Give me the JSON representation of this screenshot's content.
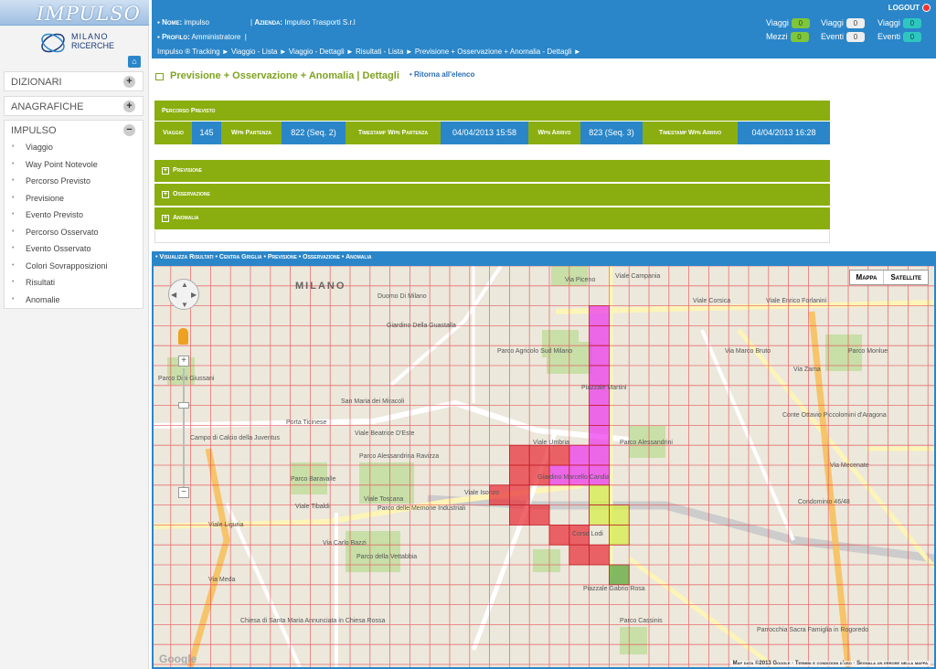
{
  "brand": {
    "logo_text": "IMPULSO",
    "org_line1": "MILANO",
    "org_line2": "RICERCHE"
  },
  "colors": {
    "blue": "#2a86c9",
    "green": "#8aae0f",
    "grid": "#e8484f",
    "magenta": "#ec3cec",
    "red": "#e8343c",
    "yellow": "#d6ee4a",
    "dark_green": "#5fa83a"
  },
  "sidebar": {
    "sections": [
      {
        "label": "DIZIONARI",
        "toggle": "+"
      },
      {
        "label": "ANAGRAFICHE",
        "toggle": "+"
      },
      {
        "label": "IMPULSO",
        "toggle": "−"
      }
    ],
    "items": [
      "Viaggio",
      "Way Point Notevole",
      "Percorso Previsto",
      "Previsione",
      "Evento Previsto",
      "Percorso Osservato",
      "Evento Osservato",
      "Colori Sovrapposizioni",
      "Risultati",
      "Anomalie"
    ]
  },
  "header": {
    "nome_label": "Nome:",
    "nome_value": "impulso",
    "azienda_label": "Azienda:",
    "azienda_value": "Impulso Trasporti S.r.l",
    "profilo_label": "Profilo:",
    "profilo_value": "Amministratore",
    "logout": "LOGOUT",
    "counters": [
      {
        "label": "Viaggi",
        "value": "0",
        "style": "green"
      },
      {
        "label": "Viaggi",
        "value": "0",
        "style": "white"
      },
      {
        "label": "Viaggi",
        "value": "0",
        "style": "teal"
      },
      {
        "label": "Mezzi",
        "value": "0",
        "style": "green"
      },
      {
        "label": "Eventi",
        "value": "0",
        "style": "white"
      },
      {
        "label": "Eventi",
        "value": "0",
        "style": "teal"
      }
    ]
  },
  "breadcrumb": "Impulso ® Tracking ► Viaggio - Lista ► Viaggio - Dettagli ► Risultati - Lista ► Previsione + Osservazione + Anomalia - Dettagli ►",
  "page_title": "Previsione + Osservazione + Anomalia | Dettagli",
  "back_link": "Ritorna all'elenco",
  "panel_title": "Percorso Previsto",
  "info": [
    {
      "label": "Viaggio",
      "value": "145"
    },
    {
      "label": "Wpn Partenza",
      "value": "822 (Seq. 2)"
    },
    {
      "label": "Timestamp Wpn Partenza",
      "value": "04/04/2013 15:58"
    },
    {
      "label": "Wpn Arrivo",
      "value": "823 (Seq. 3)"
    },
    {
      "label": "Timestamp Wpn Arrivo",
      "value": "04/04/2013 16:28"
    }
  ],
  "accordions": [
    "Previsione",
    "Osservazione",
    "Anomalia"
  ],
  "map_toolbar": [
    "Visualizza Risultati",
    "Centra Griglia",
    "Previsione",
    "Osservazione",
    "Anomalia"
  ],
  "map": {
    "type_buttons": [
      "Mappa",
      "Satellite"
    ],
    "credit": "Map data ©2013 Google · Termini e condizioni d'uso · Segnala un errore nella mappa",
    "google": "Google",
    "labels": [
      "MILANO",
      "Duomo Di Milano",
      "Giardino Della Guastalla",
      "Parco Agricolo Sud Milano",
      "Piazzale Martini",
      "San Maria dei Miracoli",
      "Porta Ticinese",
      "Campo di Calcio della Juventus",
      "Parco Alessandrini",
      "Parco Alessandrina Ravizza",
      "Giardino Marcello Candia",
      "Parco delle Memorie Industriali",
      "Parco Baravalle",
      "Parco della Vettabbia",
      "Piazzale Gabrio Rosa",
      "Parco Cassinis",
      "Chiesa di Santa Maria Annunciata in Chiesa Rossa",
      "Parrocchia Sacra Famiglia in Rogoredo",
      "Conte Ottavio Piccolomini d'Aragona",
      "Condominio 46/48",
      "Parco Monlue",
      "Parco Dini Giussani",
      "Viale Corsica",
      "Viale Enrico Forlanini",
      "Viale Beatrice D'Este",
      "Viale Toscana",
      "Viale Isonzo",
      "Viale Liguria",
      "Viale Tibaldi",
      "Via Mecenate",
      "Viale Umbria",
      "Corso Lodi",
      "Viale Campania",
      "Via Marco Bruto",
      "Via Zama",
      "Via Piceno",
      "Via Carlo Bazzi",
      "Via Meda"
    ]
  }
}
